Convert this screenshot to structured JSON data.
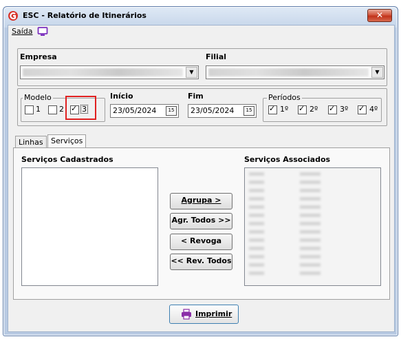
{
  "window": {
    "title": "ESC - Relatório de Itinerários",
    "close_label": "✕"
  },
  "menu": {
    "exit_label": "Saída"
  },
  "empresa": {
    "label": "Empresa"
  },
  "filial": {
    "label": "Filial"
  },
  "modelo": {
    "legend": "Modelo",
    "options": [
      {
        "label": "1",
        "checked": false
      },
      {
        "label": "2",
        "checked": false
      },
      {
        "label": "3",
        "checked": true
      }
    ]
  },
  "inicio": {
    "label": "Início",
    "value": "23/05/2024"
  },
  "fim": {
    "label": "Fim",
    "value": "23/05/2024"
  },
  "periodos": {
    "legend": "Períodos",
    "options": [
      {
        "label": "1º",
        "checked": true
      },
      {
        "label": "2º",
        "checked": true
      },
      {
        "label": "3º",
        "checked": true
      },
      {
        "label": "4º",
        "checked": true
      }
    ]
  },
  "tabs": [
    {
      "label": "Linhas"
    },
    {
      "label": "Serviços"
    }
  ],
  "servicos": {
    "cadastrados_label": "Serviços Cadastrados",
    "associados_label": "Serviços Associados"
  },
  "buttons": {
    "agrupa": "Agrupa >",
    "agr_todos": "Agr. Todos >>",
    "revoga": "< Revoga",
    "rev_todos": "<< Rev. Todos",
    "imprimir": "Imprimir"
  },
  "icons": {
    "app": "app-logo-icon",
    "monitor": "monitor-icon",
    "calendar": "calendar-icon",
    "printer": "printer-icon"
  },
  "colors": {
    "highlight": "#e02020",
    "accent": "#c62828",
    "monitor": "#7b2fbe",
    "printer": "#8b2fa8"
  }
}
